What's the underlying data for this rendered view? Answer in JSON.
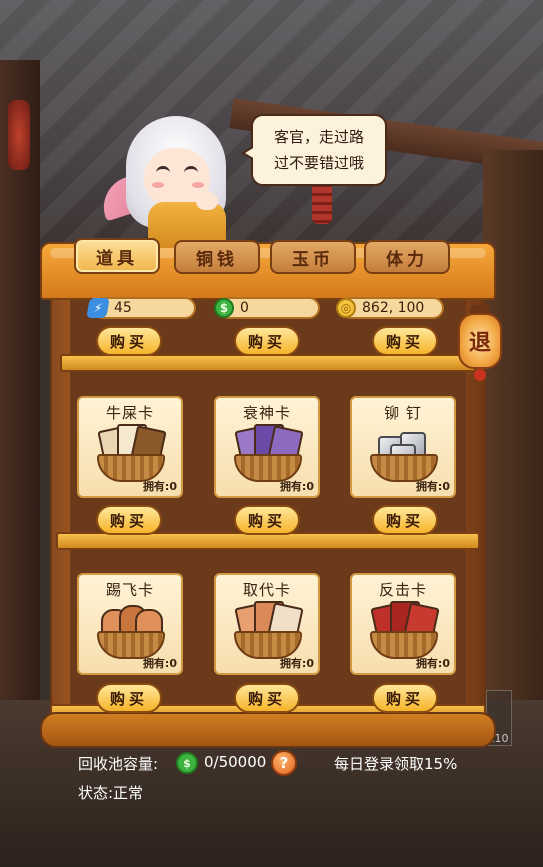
{
  "npc": {
    "speech_line1": "客官，走过路",
    "speech_line2": "过不要错过哦"
  },
  "tabs": [
    {
      "label": "道具",
      "active": true
    },
    {
      "label": "铜钱",
      "active": false
    },
    {
      "label": "玉币",
      "active": false
    },
    {
      "label": "体力",
      "active": false
    }
  ],
  "resources": {
    "energy": "45",
    "green_coin": "0",
    "gold_coin": "862, 100"
  },
  "exit_label": "退",
  "top_row_buy": [
    "购买",
    "购买",
    "购买"
  ],
  "items": [
    {
      "name": "牛屎卡",
      "owned": "拥有:0",
      "buy": "购买"
    },
    {
      "name": "衰神卡",
      "owned": "拥有:0",
      "buy": "购买"
    },
    {
      "name": "铆 钉",
      "owned": "拥有:0",
      "buy": "购买"
    },
    {
      "name": "踢飞卡",
      "owned": "拥有:0",
      "buy": "购买"
    },
    {
      "name": "取代卡",
      "owned": "拥有:0",
      "buy": "购买"
    },
    {
      "name": "反击卡",
      "owned": "拥有:0",
      "buy": "购买"
    }
  ],
  "footer": {
    "pool_label": "回收池容量:",
    "pool_value": "0/50000",
    "daily_bonus": "每日登录领取15%",
    "status": "状态:正常",
    "help": "?"
  },
  "side_badge": "x10",
  "colors": {
    "frame_orange": "#f6a83a",
    "cabinet_brown": "#8a4a1e",
    "buy_yellow": "#f6b42a"
  }
}
